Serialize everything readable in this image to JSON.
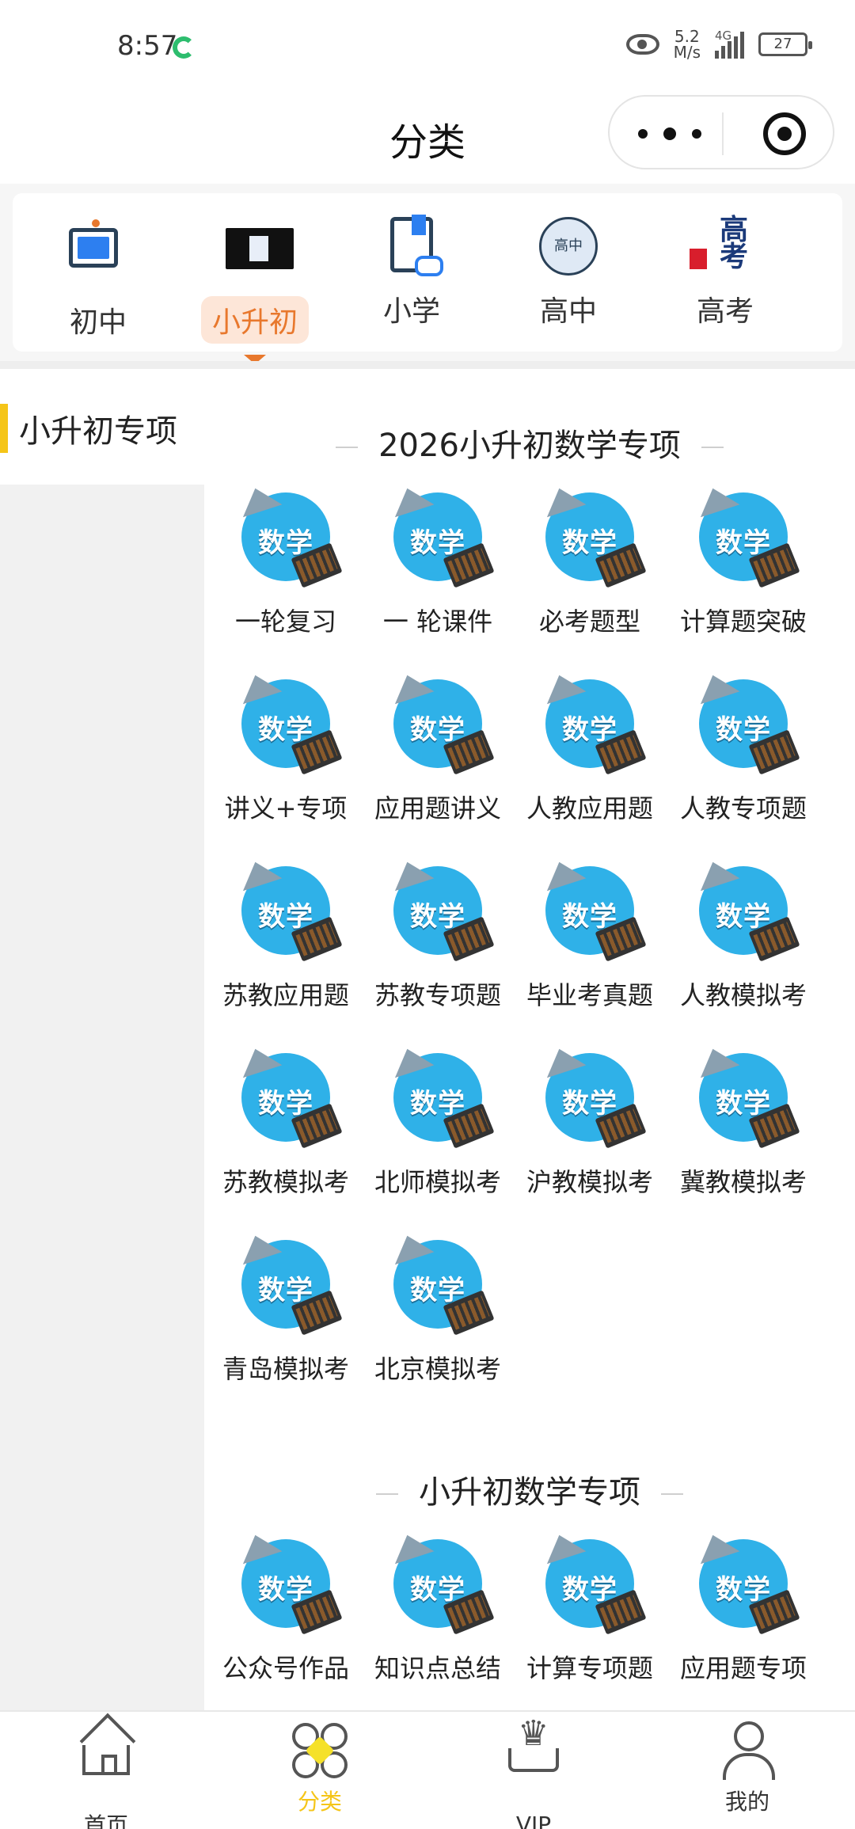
{
  "status_bar": {
    "time": "8:57",
    "net_speed_value": "5.2",
    "net_speed_unit": "M/s",
    "network_type": "4G",
    "battery": "27"
  },
  "header": {
    "title": "分类"
  },
  "category_tabs": [
    {
      "label": "初中",
      "icon": "monitor-icon"
    },
    {
      "label": "小升初",
      "icon": "classroom-icon",
      "active": true
    },
    {
      "label": "小学",
      "icon": "book-icon"
    },
    {
      "label": "高中",
      "icon": "senior-badge-icon"
    },
    {
      "label": "高考",
      "icon": "gaokao-icon"
    }
  ],
  "sidebar": {
    "items": [
      {
        "label": "小升初专项",
        "active": true
      }
    ]
  },
  "sections": [
    {
      "title": "2026小升初数学专项",
      "items": [
        "一轮复习",
        "一 轮课件",
        "必考题型",
        "计算题突破",
        "讲义+专项",
        "应用题讲义",
        "人教应用题",
        "人教专项题",
        "苏教应用题",
        "苏教专项题",
        "毕业考真题",
        "人教模拟考",
        "苏教模拟考",
        "北师模拟考",
        "沪教模拟考",
        "冀教模拟考",
        "青岛模拟考",
        "北京模拟考"
      ]
    },
    {
      "title": "小升初数学专项",
      "items": [
        "公众号作品",
        "知识点总结",
        "计算专项题",
        "应用题专项"
      ]
    }
  ],
  "item_icon_text": "数学",
  "tabbar": [
    {
      "label": "首页",
      "icon": "home-icon"
    },
    {
      "label": "分类",
      "icon": "category-icon",
      "active": true
    },
    {
      "label": "VIP",
      "icon": "crown-icon"
    },
    {
      "label": "我的",
      "icon": "user-icon"
    }
  ],
  "colors": {
    "accent_yellow": "#f5c518",
    "accent_orange": "#e8782d",
    "icon_blue": "#2fb1e8"
  }
}
